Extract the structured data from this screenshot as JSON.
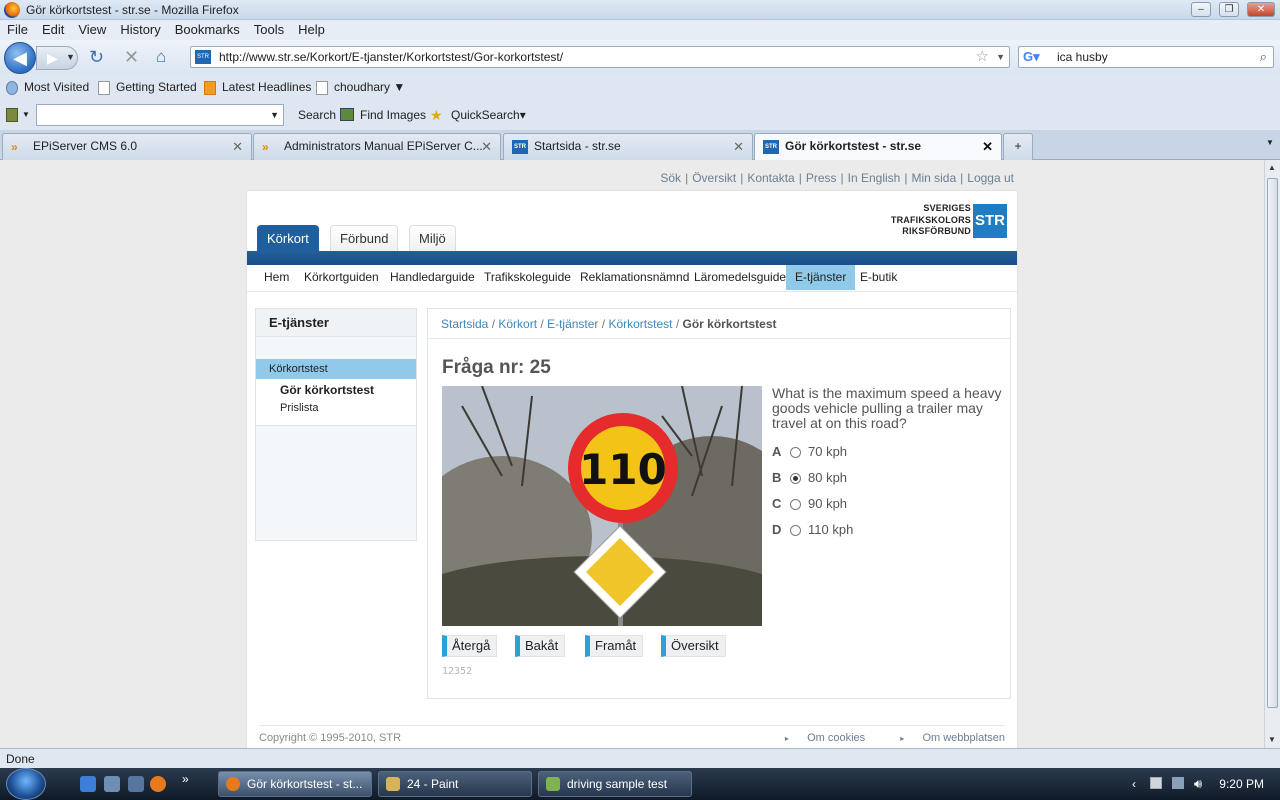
{
  "window": {
    "title": "Gör körkortstest - str.se - Mozilla Firefox"
  },
  "menu": [
    "File",
    "Edit",
    "View",
    "History",
    "Bookmarks",
    "Tools",
    "Help"
  ],
  "url": "http://www.str.se/Korkort/E-tjanster/Korkortstest/Gor-korkortstest/",
  "search_value": "ica husby",
  "bookmarks": [
    "Most Visited",
    "Getting Started",
    "Latest Headlines",
    "choudhary ▼"
  ],
  "toolbar2": {
    "search": "Search",
    "find_images": "Find Images",
    "quicksearch": "QuickSearch▾"
  },
  "tabs": [
    "EPiServer CMS 6.0",
    "Administrators Manual EPiServer C...",
    "Startsida - str.se",
    "Gör körkortstest - str.se"
  ],
  "site": {
    "top_links": [
      "Sök",
      "Översikt",
      "Kontakta",
      "Press",
      "In English",
      "Min sida",
      "Logga ut"
    ],
    "main_tabs": [
      "Körkort",
      "Förbund",
      "Miljö"
    ],
    "logo_lines": [
      "SVERIGES",
      "TRAFIKSKOLORS",
      "RIKSFÖRBUND"
    ],
    "logo_badge": "STR",
    "sub_nav": [
      "Hem",
      "Körkortguiden",
      "Handledarguide",
      "Trafikskoleguide",
      "Reklamationsnämnd",
      "Läromedelsguide",
      "E-tjänster",
      "E-butik"
    ],
    "left_title": "E-tjänster",
    "left_selected": "Körkortstest",
    "left_sub": [
      "Gör körkortstest",
      "Prislista"
    ],
    "breadcrumb": [
      "Startsida",
      "Körkort",
      "E-tjänster",
      "Körkortstest"
    ],
    "breadcrumb_current": "Gör körkortstest",
    "question_title": "Fråga nr: 25",
    "sign_speed": "110",
    "question": "What is the maximum speed a heavy goods vehicle pulling a trailer may travel at on this road?",
    "options": [
      {
        "key": "A",
        "label": "70 kph",
        "selected": false
      },
      {
        "key": "B",
        "label": "80 kph",
        "selected": true
      },
      {
        "key": "C",
        "label": "90 kph",
        "selected": false
      },
      {
        "key": "D",
        "label": "110 kph",
        "selected": false
      }
    ],
    "buttons": [
      "Återgå",
      "Bakåt",
      "Framåt",
      "Översikt"
    ],
    "question_id": "12352",
    "copyright": "Copyright © 1995-2010, STR",
    "footer_links": [
      "Om cookies",
      "Om webbplatsen"
    ]
  },
  "status": "Done",
  "taskbar": {
    "tasks": [
      "Gör körkortstest - st...",
      "24 - Paint",
      "driving sample test"
    ],
    "clock": "9:20 PM"
  },
  "colors": {
    "accent": "#1f5f9e",
    "highlight": "#8fcaea",
    "button_marker": "#2aa2d8"
  }
}
